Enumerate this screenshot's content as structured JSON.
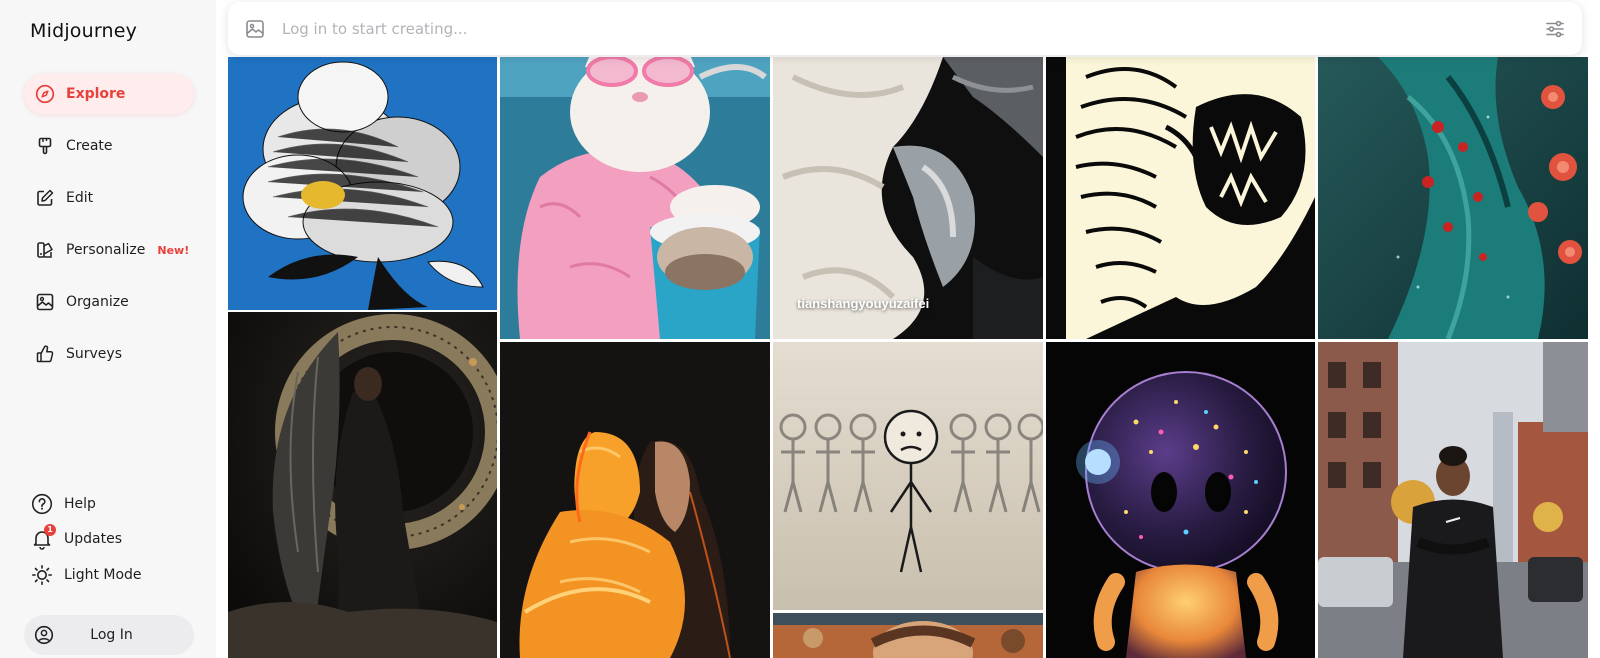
{
  "app": {
    "brand": "Midjourney"
  },
  "sidebar": {
    "items": [
      {
        "label": "Explore",
        "icon": "compass-icon",
        "active": true
      },
      {
        "label": "Create",
        "icon": "paintbrush-icon"
      },
      {
        "label": "Edit",
        "icon": "edit-icon"
      },
      {
        "label": "Personalize",
        "icon": "palette-icon",
        "badge": "New!"
      },
      {
        "label": "Organize",
        "icon": "image-icon"
      },
      {
        "label": "Surveys",
        "icon": "thumbs-up-icon"
      }
    ],
    "bottom": [
      {
        "label": "Help",
        "icon": "help-icon"
      },
      {
        "label": "Updates",
        "icon": "bell-icon",
        "count": "1"
      },
      {
        "label": "Light Mode",
        "icon": "sun-icon"
      }
    ],
    "login": {
      "label": "Log In",
      "icon": "user-icon"
    }
  },
  "search": {
    "placeholder": "Log in to start creating...",
    "icon": "image-icon",
    "filter_icon": "sliders-icon"
  },
  "gallery": {
    "tiles": [
      {
        "name": "tile-flower"
      },
      {
        "name": "tile-pink-cat"
      },
      {
        "name": "tile-paint-texture",
        "caption": "tianshangyouyuzaifei"
      },
      {
        "name": "tile-tiger"
      },
      {
        "name": "tile-teal-dress"
      },
      {
        "name": "tile-winged-figure"
      },
      {
        "name": "tile-fire-embrace"
      },
      {
        "name": "tile-stick-figures"
      },
      {
        "name": "tile-glowing-robot"
      },
      {
        "name": "tile-street-portrait"
      },
      {
        "name": "tile-rusty-portrait"
      }
    ]
  },
  "colors": {
    "accent": "#e8403a",
    "active_bg": "#ffecec",
    "sidebar_bg": "#f7f7f8"
  }
}
